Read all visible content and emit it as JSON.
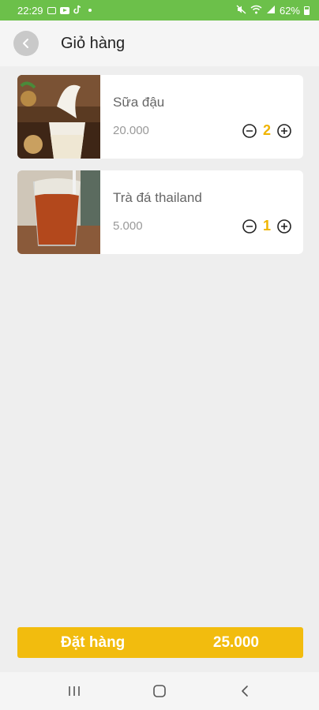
{
  "status_bar": {
    "time": "22:29",
    "battery": "62%",
    "icons": [
      "image-icon",
      "youtube-icon",
      "tiktok-icon",
      "dot-icon",
      "mute-icon",
      "wifi-icon",
      "signal-icon",
      "battery-icon"
    ]
  },
  "header": {
    "title": "Giỏ hàng",
    "back_icon": "chevron-left-icon"
  },
  "cart": {
    "items": [
      {
        "name": "Sữa đậu",
        "price": "20.000",
        "quantity": "2"
      },
      {
        "name": "Trà đá thailand",
        "price": "5.000",
        "quantity": "1"
      }
    ]
  },
  "order": {
    "label": "Đặt hàng",
    "total": "25.000"
  },
  "nav": {
    "icons": [
      "recent-apps-icon",
      "home-icon",
      "back-icon"
    ]
  },
  "colors": {
    "status_bar": "#6cc04a",
    "accent": "#f2bc0e",
    "quantity": "#f0b400",
    "background": "#eeeeee"
  }
}
